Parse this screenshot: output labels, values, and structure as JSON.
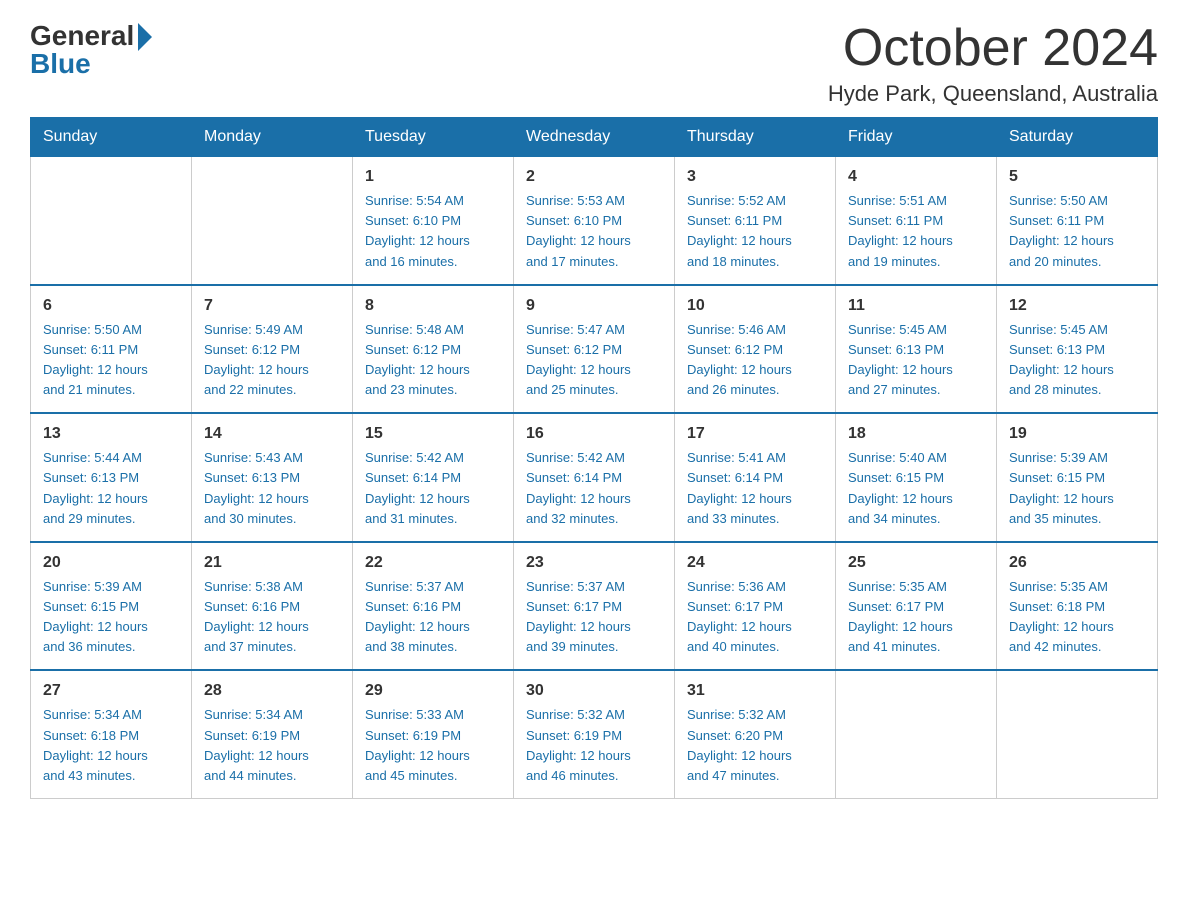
{
  "logo": {
    "general": "General",
    "blue": "Blue"
  },
  "title": "October 2024",
  "subtitle": "Hyde Park, Queensland, Australia",
  "days_of_week": [
    "Sunday",
    "Monday",
    "Tuesday",
    "Wednesday",
    "Thursday",
    "Friday",
    "Saturday"
  ],
  "weeks": [
    [
      {
        "day": "",
        "info": ""
      },
      {
        "day": "",
        "info": ""
      },
      {
        "day": "1",
        "info": "Sunrise: 5:54 AM\nSunset: 6:10 PM\nDaylight: 12 hours\nand 16 minutes."
      },
      {
        "day": "2",
        "info": "Sunrise: 5:53 AM\nSunset: 6:10 PM\nDaylight: 12 hours\nand 17 minutes."
      },
      {
        "day": "3",
        "info": "Sunrise: 5:52 AM\nSunset: 6:11 PM\nDaylight: 12 hours\nand 18 minutes."
      },
      {
        "day": "4",
        "info": "Sunrise: 5:51 AM\nSunset: 6:11 PM\nDaylight: 12 hours\nand 19 minutes."
      },
      {
        "day": "5",
        "info": "Sunrise: 5:50 AM\nSunset: 6:11 PM\nDaylight: 12 hours\nand 20 minutes."
      }
    ],
    [
      {
        "day": "6",
        "info": "Sunrise: 5:50 AM\nSunset: 6:11 PM\nDaylight: 12 hours\nand 21 minutes."
      },
      {
        "day": "7",
        "info": "Sunrise: 5:49 AM\nSunset: 6:12 PM\nDaylight: 12 hours\nand 22 minutes."
      },
      {
        "day": "8",
        "info": "Sunrise: 5:48 AM\nSunset: 6:12 PM\nDaylight: 12 hours\nand 23 minutes."
      },
      {
        "day": "9",
        "info": "Sunrise: 5:47 AM\nSunset: 6:12 PM\nDaylight: 12 hours\nand 25 minutes."
      },
      {
        "day": "10",
        "info": "Sunrise: 5:46 AM\nSunset: 6:12 PM\nDaylight: 12 hours\nand 26 minutes."
      },
      {
        "day": "11",
        "info": "Sunrise: 5:45 AM\nSunset: 6:13 PM\nDaylight: 12 hours\nand 27 minutes."
      },
      {
        "day": "12",
        "info": "Sunrise: 5:45 AM\nSunset: 6:13 PM\nDaylight: 12 hours\nand 28 minutes."
      }
    ],
    [
      {
        "day": "13",
        "info": "Sunrise: 5:44 AM\nSunset: 6:13 PM\nDaylight: 12 hours\nand 29 minutes."
      },
      {
        "day": "14",
        "info": "Sunrise: 5:43 AM\nSunset: 6:13 PM\nDaylight: 12 hours\nand 30 minutes."
      },
      {
        "day": "15",
        "info": "Sunrise: 5:42 AM\nSunset: 6:14 PM\nDaylight: 12 hours\nand 31 minutes."
      },
      {
        "day": "16",
        "info": "Sunrise: 5:42 AM\nSunset: 6:14 PM\nDaylight: 12 hours\nand 32 minutes."
      },
      {
        "day": "17",
        "info": "Sunrise: 5:41 AM\nSunset: 6:14 PM\nDaylight: 12 hours\nand 33 minutes."
      },
      {
        "day": "18",
        "info": "Sunrise: 5:40 AM\nSunset: 6:15 PM\nDaylight: 12 hours\nand 34 minutes."
      },
      {
        "day": "19",
        "info": "Sunrise: 5:39 AM\nSunset: 6:15 PM\nDaylight: 12 hours\nand 35 minutes."
      }
    ],
    [
      {
        "day": "20",
        "info": "Sunrise: 5:39 AM\nSunset: 6:15 PM\nDaylight: 12 hours\nand 36 minutes."
      },
      {
        "day": "21",
        "info": "Sunrise: 5:38 AM\nSunset: 6:16 PM\nDaylight: 12 hours\nand 37 minutes."
      },
      {
        "day": "22",
        "info": "Sunrise: 5:37 AM\nSunset: 6:16 PM\nDaylight: 12 hours\nand 38 minutes."
      },
      {
        "day": "23",
        "info": "Sunrise: 5:37 AM\nSunset: 6:17 PM\nDaylight: 12 hours\nand 39 minutes."
      },
      {
        "day": "24",
        "info": "Sunrise: 5:36 AM\nSunset: 6:17 PM\nDaylight: 12 hours\nand 40 minutes."
      },
      {
        "day": "25",
        "info": "Sunrise: 5:35 AM\nSunset: 6:17 PM\nDaylight: 12 hours\nand 41 minutes."
      },
      {
        "day": "26",
        "info": "Sunrise: 5:35 AM\nSunset: 6:18 PM\nDaylight: 12 hours\nand 42 minutes."
      }
    ],
    [
      {
        "day": "27",
        "info": "Sunrise: 5:34 AM\nSunset: 6:18 PM\nDaylight: 12 hours\nand 43 minutes."
      },
      {
        "day": "28",
        "info": "Sunrise: 5:34 AM\nSunset: 6:19 PM\nDaylight: 12 hours\nand 44 minutes."
      },
      {
        "day": "29",
        "info": "Sunrise: 5:33 AM\nSunset: 6:19 PM\nDaylight: 12 hours\nand 45 minutes."
      },
      {
        "day": "30",
        "info": "Sunrise: 5:32 AM\nSunset: 6:19 PM\nDaylight: 12 hours\nand 46 minutes."
      },
      {
        "day": "31",
        "info": "Sunrise: 5:32 AM\nSunset: 6:20 PM\nDaylight: 12 hours\nand 47 minutes."
      },
      {
        "day": "",
        "info": ""
      },
      {
        "day": "",
        "info": ""
      }
    ]
  ]
}
